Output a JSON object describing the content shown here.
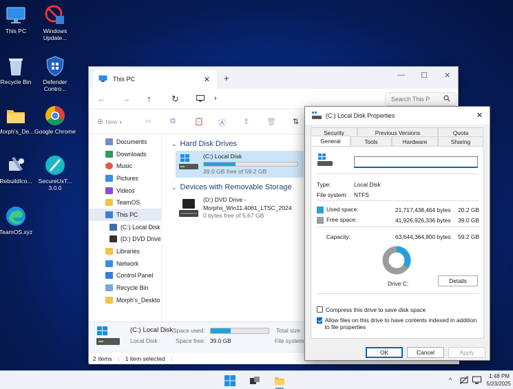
{
  "desktop": {
    "icons": [
      {
        "label": "This PC"
      },
      {
        "label": "Windows Update..."
      },
      {
        "label": "Recycle Bin"
      },
      {
        "label": "Defender Contro..."
      },
      {
        "label": "Morph's_De..."
      },
      {
        "label": "Google Chrome"
      },
      {
        "label": "RebuildIco..."
      },
      {
        "label": "SecureUxT... 3.0.0"
      },
      {
        "label": "TeamOS.xyz"
      }
    ]
  },
  "explorer": {
    "tab_title": "This PC",
    "tab_close": "✕",
    "new_tab": "+",
    "minimize": "—",
    "maximize": "☐",
    "close": "✕",
    "nav": {
      "back": "←",
      "forward": "→",
      "up": "↑",
      "refresh": "↻",
      "path_sep": "›"
    },
    "search_placeholder": "Search This P",
    "cmd": {
      "new_label": "New"
    },
    "sidebar": [
      {
        "label": "Documents",
        "color": "#6d8fc7"
      },
      {
        "label": "Downloads",
        "color": "#2f9b5b"
      },
      {
        "label": "Music",
        "color": "#e0584a"
      },
      {
        "label": "Pictures",
        "color": "#3a8de0"
      },
      {
        "label": "Videos",
        "color": "#8a4fd0"
      },
      {
        "label": "TeamOS",
        "color": "#f2c34c"
      },
      {
        "label": "This PC",
        "color": "#3a7fd4"
      },
      {
        "label": "(C:) Local Disk",
        "color": "#3d6fb0"
      },
      {
        "label": "(D:) DVD Drive",
        "color": "#333333"
      },
      {
        "label": "Libraries",
        "color": "#f2c34c"
      },
      {
        "label": "Network",
        "color": "#3a8de0"
      },
      {
        "label": "Control Panel",
        "color": "#3a7fd4"
      },
      {
        "label": "Recycle Bin",
        "color": "#7aa9d8"
      },
      {
        "label": "Morph's_Deskto",
        "color": "#f2c34c"
      }
    ],
    "groups": {
      "hdd": "Hard Disk Drives",
      "removable": "Devices with Removable Storage"
    },
    "drive_c": {
      "name": "(C:) Local Disk",
      "free": "39.0 GB free of 59.2 GB",
      "used_fraction": 0.34
    },
    "drive_d": {
      "name": "(D:) DVD Drive -",
      "name2": "Morphs_Win11.4061_LTSC_2024",
      "free": "0 bytes free of 5.67 GB"
    },
    "details": {
      "name": "(C:) Local Disk",
      "type": "Local Disk",
      "space_used_label": "Space used:",
      "space_free_label": "Space free:",
      "space_free_value": "39.0 GB",
      "total_label": "Total size",
      "fs_label": "File system:",
      "used_fraction": 0.34
    },
    "status": {
      "items": "2 items",
      "selected": "1 item selected"
    }
  },
  "properties": {
    "title": "(C:) Local Disk Properties",
    "close": "✕",
    "tabs_top": [
      "Security",
      "Previous Versions",
      "Quota"
    ],
    "tabs_bottom": [
      "General",
      "Tools",
      "Hardware",
      "Sharing"
    ],
    "name_value": "",
    "type_label": "Type:",
    "type_value": "Local Disk",
    "fs_label": "File system:",
    "fs_value": "NTFS",
    "used": {
      "label": "Used space:",
      "bytes": "21,717,438,464 bytes",
      "size": "20.2 GB",
      "color": "#26a0da"
    },
    "free": {
      "label": "Free space:",
      "bytes": "41,926,926,336 bytes",
      "size": "39.0 GB",
      "color": "#9c9c9c"
    },
    "capacity": {
      "label": "Capacity:",
      "bytes": "63,644,364,800 bytes",
      "size": "59.2 GB"
    },
    "used_fraction": 0.34,
    "drive_label": "Drive C:",
    "details_button": "Details",
    "compress_label": "Compress this drive to save disk space",
    "compress_checked": false,
    "index_label": "Allow files on this drive to have contents indexed in addition to file properties",
    "index_checked": true,
    "ok": "OK",
    "cancel": "Cancel",
    "apply": "Apply"
  },
  "taskbar": {
    "time": "1:48 PM",
    "date": "5/23/2025",
    "chevron": "^"
  }
}
